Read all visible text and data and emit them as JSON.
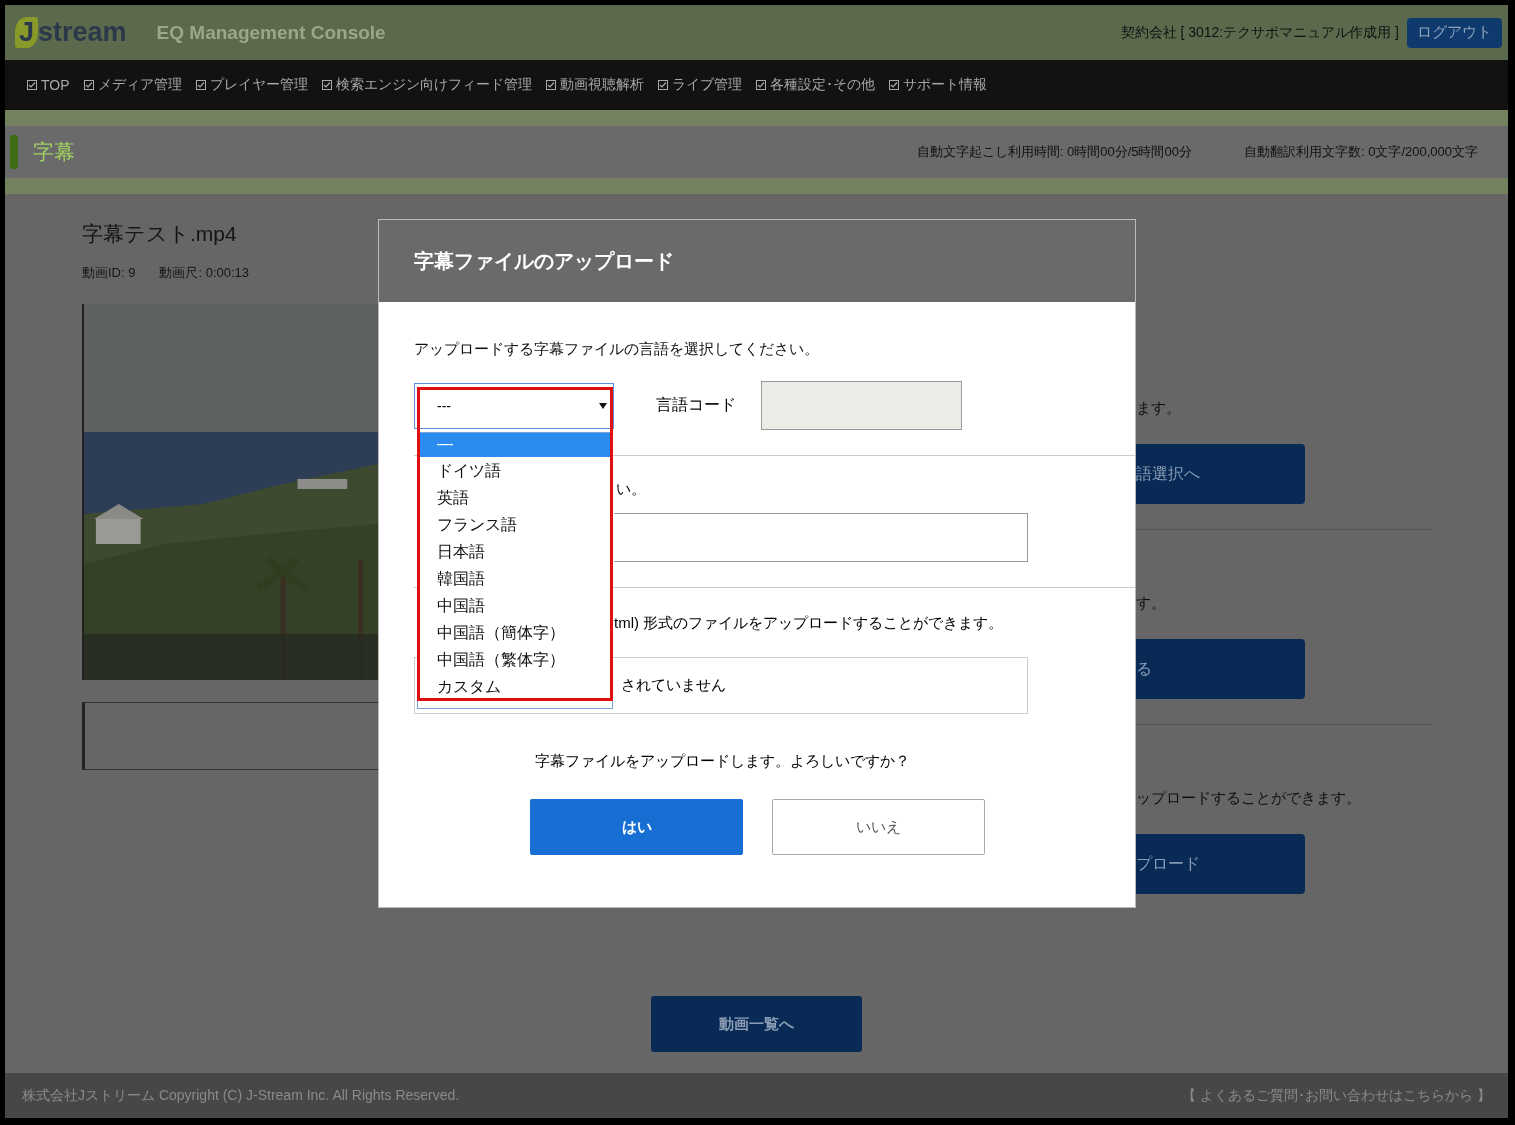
{
  "header": {
    "logo_initial": "J",
    "logo_rest": "stream",
    "app_title": "EQ Management Console",
    "contract": "契約会社 [ 3012:テクサポマニュアル作成用 ]",
    "logout": "ログアウト"
  },
  "nav": [
    {
      "label": "TOP"
    },
    {
      "label": "メディア管理"
    },
    {
      "label": "プレイヤー管理"
    },
    {
      "label": "検索エンジン向けフィード管理"
    },
    {
      "label": "動画視聴解析"
    },
    {
      "label": "ライブ管理"
    },
    {
      "label": "各種設定･その他"
    },
    {
      "label": "サポート情報"
    }
  ],
  "page_header": {
    "title": "字幕",
    "usage": [
      "自動文字起こし利用時間: 0時間00分/5時間00分",
      "自動翻訳利用文字数: 0文字/200,000文字"
    ]
  },
  "video": {
    "title": "字幕テスト.mp4",
    "id": "動画ID: 9",
    "duration": "動画尺: 0:00:13"
  },
  "background_sections": [
    {
      "text": "ます。",
      "button": "語選択へ"
    },
    {
      "text": "す。",
      "button": "る"
    },
    {
      "text": "ップロードすることができます。",
      "button": "プロード"
    }
  ],
  "back_button": "動画一覧へ",
  "footer": {
    "copyright": "株式会社Jストリーム  Copyright (C) J-Stream Inc. All Rights Reserved.",
    "support": "【 よくあるご質問･お問い合わせはこちらから 】"
  },
  "modal": {
    "title": "字幕ファイルのアップロード",
    "instruction": "アップロードする字幕ファイルの言語を選択してください。",
    "language_select": {
      "value": "---",
      "expanded": true,
      "options": [
        {
          "label": "—",
          "selected": true
        },
        {
          "label": "ドイツ語",
          "selected": false
        },
        {
          "label": "英語",
          "selected": false
        },
        {
          "label": "フランス語",
          "selected": false
        },
        {
          "label": "日本語",
          "selected": false
        },
        {
          "label": "韓国語",
          "selected": false
        },
        {
          "label": "中国語",
          "selected": false
        },
        {
          "label": "中国語（簡体字）",
          "selected": false
        },
        {
          "label": "中国語（繁体字）",
          "selected": false
        },
        {
          "label": "カスタム",
          "selected": false
        }
      ]
    },
    "language_code_label": "言語コード",
    "section2_text": "い。",
    "section3_text": "tml) 形式のファイルをアップロードすることができます。",
    "file_status": "されていません",
    "confirm": "字幕ファイルをアップロードします。よろしいですか？",
    "yes": "はい",
    "no": "いいえ"
  }
}
